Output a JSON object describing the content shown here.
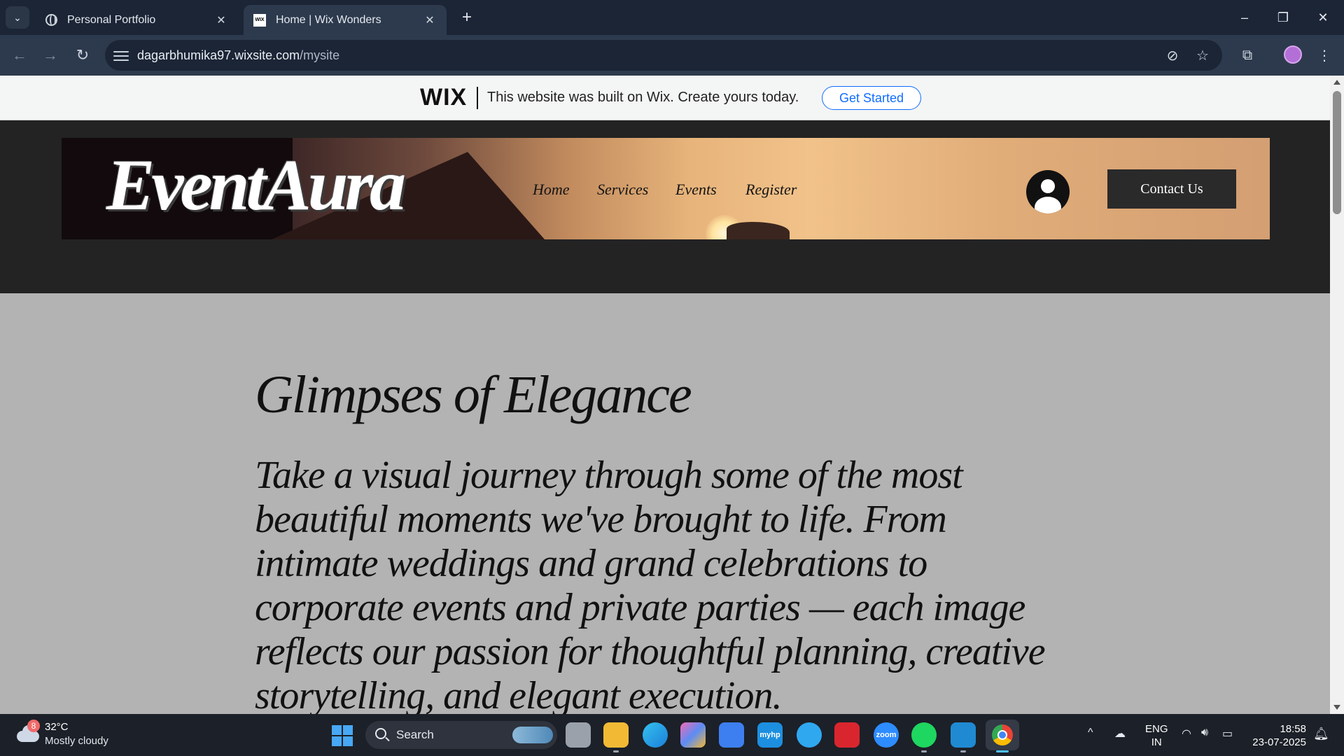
{
  "browser": {
    "tabs": [
      {
        "title": "Personal Portfolio",
        "active": false
      },
      {
        "title": "Home | Wix Wonders",
        "active": true
      }
    ],
    "new_tab_label": "+",
    "url_domain": "dagarbhumika97.wixsite.com",
    "url_path": "/mysite",
    "window_controls": {
      "minimize": "–",
      "restore": "❐",
      "close": "✕"
    }
  },
  "wix_banner": {
    "logo": "WIX",
    "message": "This website was built on Wix. Create yours today.",
    "cta": "Get Started",
    "accent_color": "#116dff"
  },
  "site": {
    "brand": "EventAura",
    "nav": [
      "Home",
      "Services",
      "Events",
      "Register"
    ],
    "contact_button": "Contact Us"
  },
  "content": {
    "headline": "Glimpses of Elegance",
    "paragraph": "Take a visual journey through some of the most beautiful moments we've brought to life. From intimate weddings and grand celebrations to corporate events and private parties — each image reflects our passion for thoughtful planning, creative storytelling, and elegant execution."
  },
  "taskbar": {
    "weather_badge": "8",
    "temperature": "32°C",
    "condition": "Mostly cloudy",
    "search_label": "Search",
    "apps": [
      "task-view",
      "file-explorer",
      "edge",
      "copilot",
      "microsoft-store",
      "myhp",
      "help",
      "mcafee",
      "zoom",
      "spotify",
      "vscode",
      "chrome"
    ],
    "app_labels": {
      "myhp": "myhp",
      "zoom": "zoom"
    },
    "language_line1": "ENG",
    "language_line2": "IN",
    "time": "18:58",
    "date": "23-07-2025"
  }
}
